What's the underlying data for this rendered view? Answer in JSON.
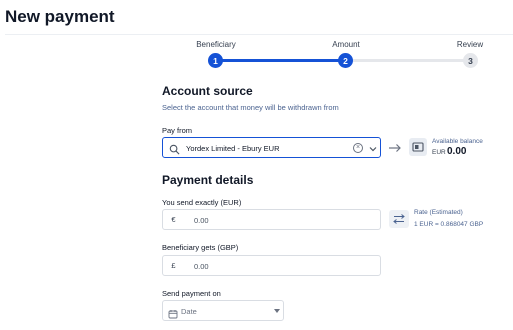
{
  "page": {
    "title": "New payment"
  },
  "stepper": {
    "steps": [
      {
        "label": "Beneficiary",
        "number": "1",
        "state": "completed"
      },
      {
        "label": "Amount",
        "number": "2",
        "state": "active"
      },
      {
        "label": "Review",
        "number": "3",
        "state": "upcoming"
      }
    ]
  },
  "account_source": {
    "title": "Account source",
    "hint": "Select the account that money will be withdrawn from",
    "pay_from_label": "Pay from",
    "pay_from_value": "Yordex Limited - Ebury EUR",
    "available_balance_label": "Available balance",
    "available_balance_currency": "EUR",
    "available_balance_amount": "0.00"
  },
  "payment_details": {
    "title": "Payment details",
    "send_label": "You send exactly (EUR)",
    "send_prefix": "€",
    "send_value": "0.00",
    "rate_label": "Rate (Estimated)",
    "rate_value": "1 EUR = 0.868047 GBP",
    "receive_label": "Beneficiary gets (GBP)",
    "receive_prefix": "£",
    "receive_value": "0.00",
    "send_on_label": "Send payment on",
    "date_placeholder": "Date"
  },
  "colors": {
    "accent": "#1552d6",
    "step_inactive": "#e5e7eb",
    "muted_text": "#4b6390"
  },
  "icons": [
    "search-icon",
    "clear-icon",
    "chevron-down-icon",
    "arrow-right-icon",
    "wallet-icon",
    "swap-icon",
    "calendar-icon",
    "caret-down-icon"
  ]
}
